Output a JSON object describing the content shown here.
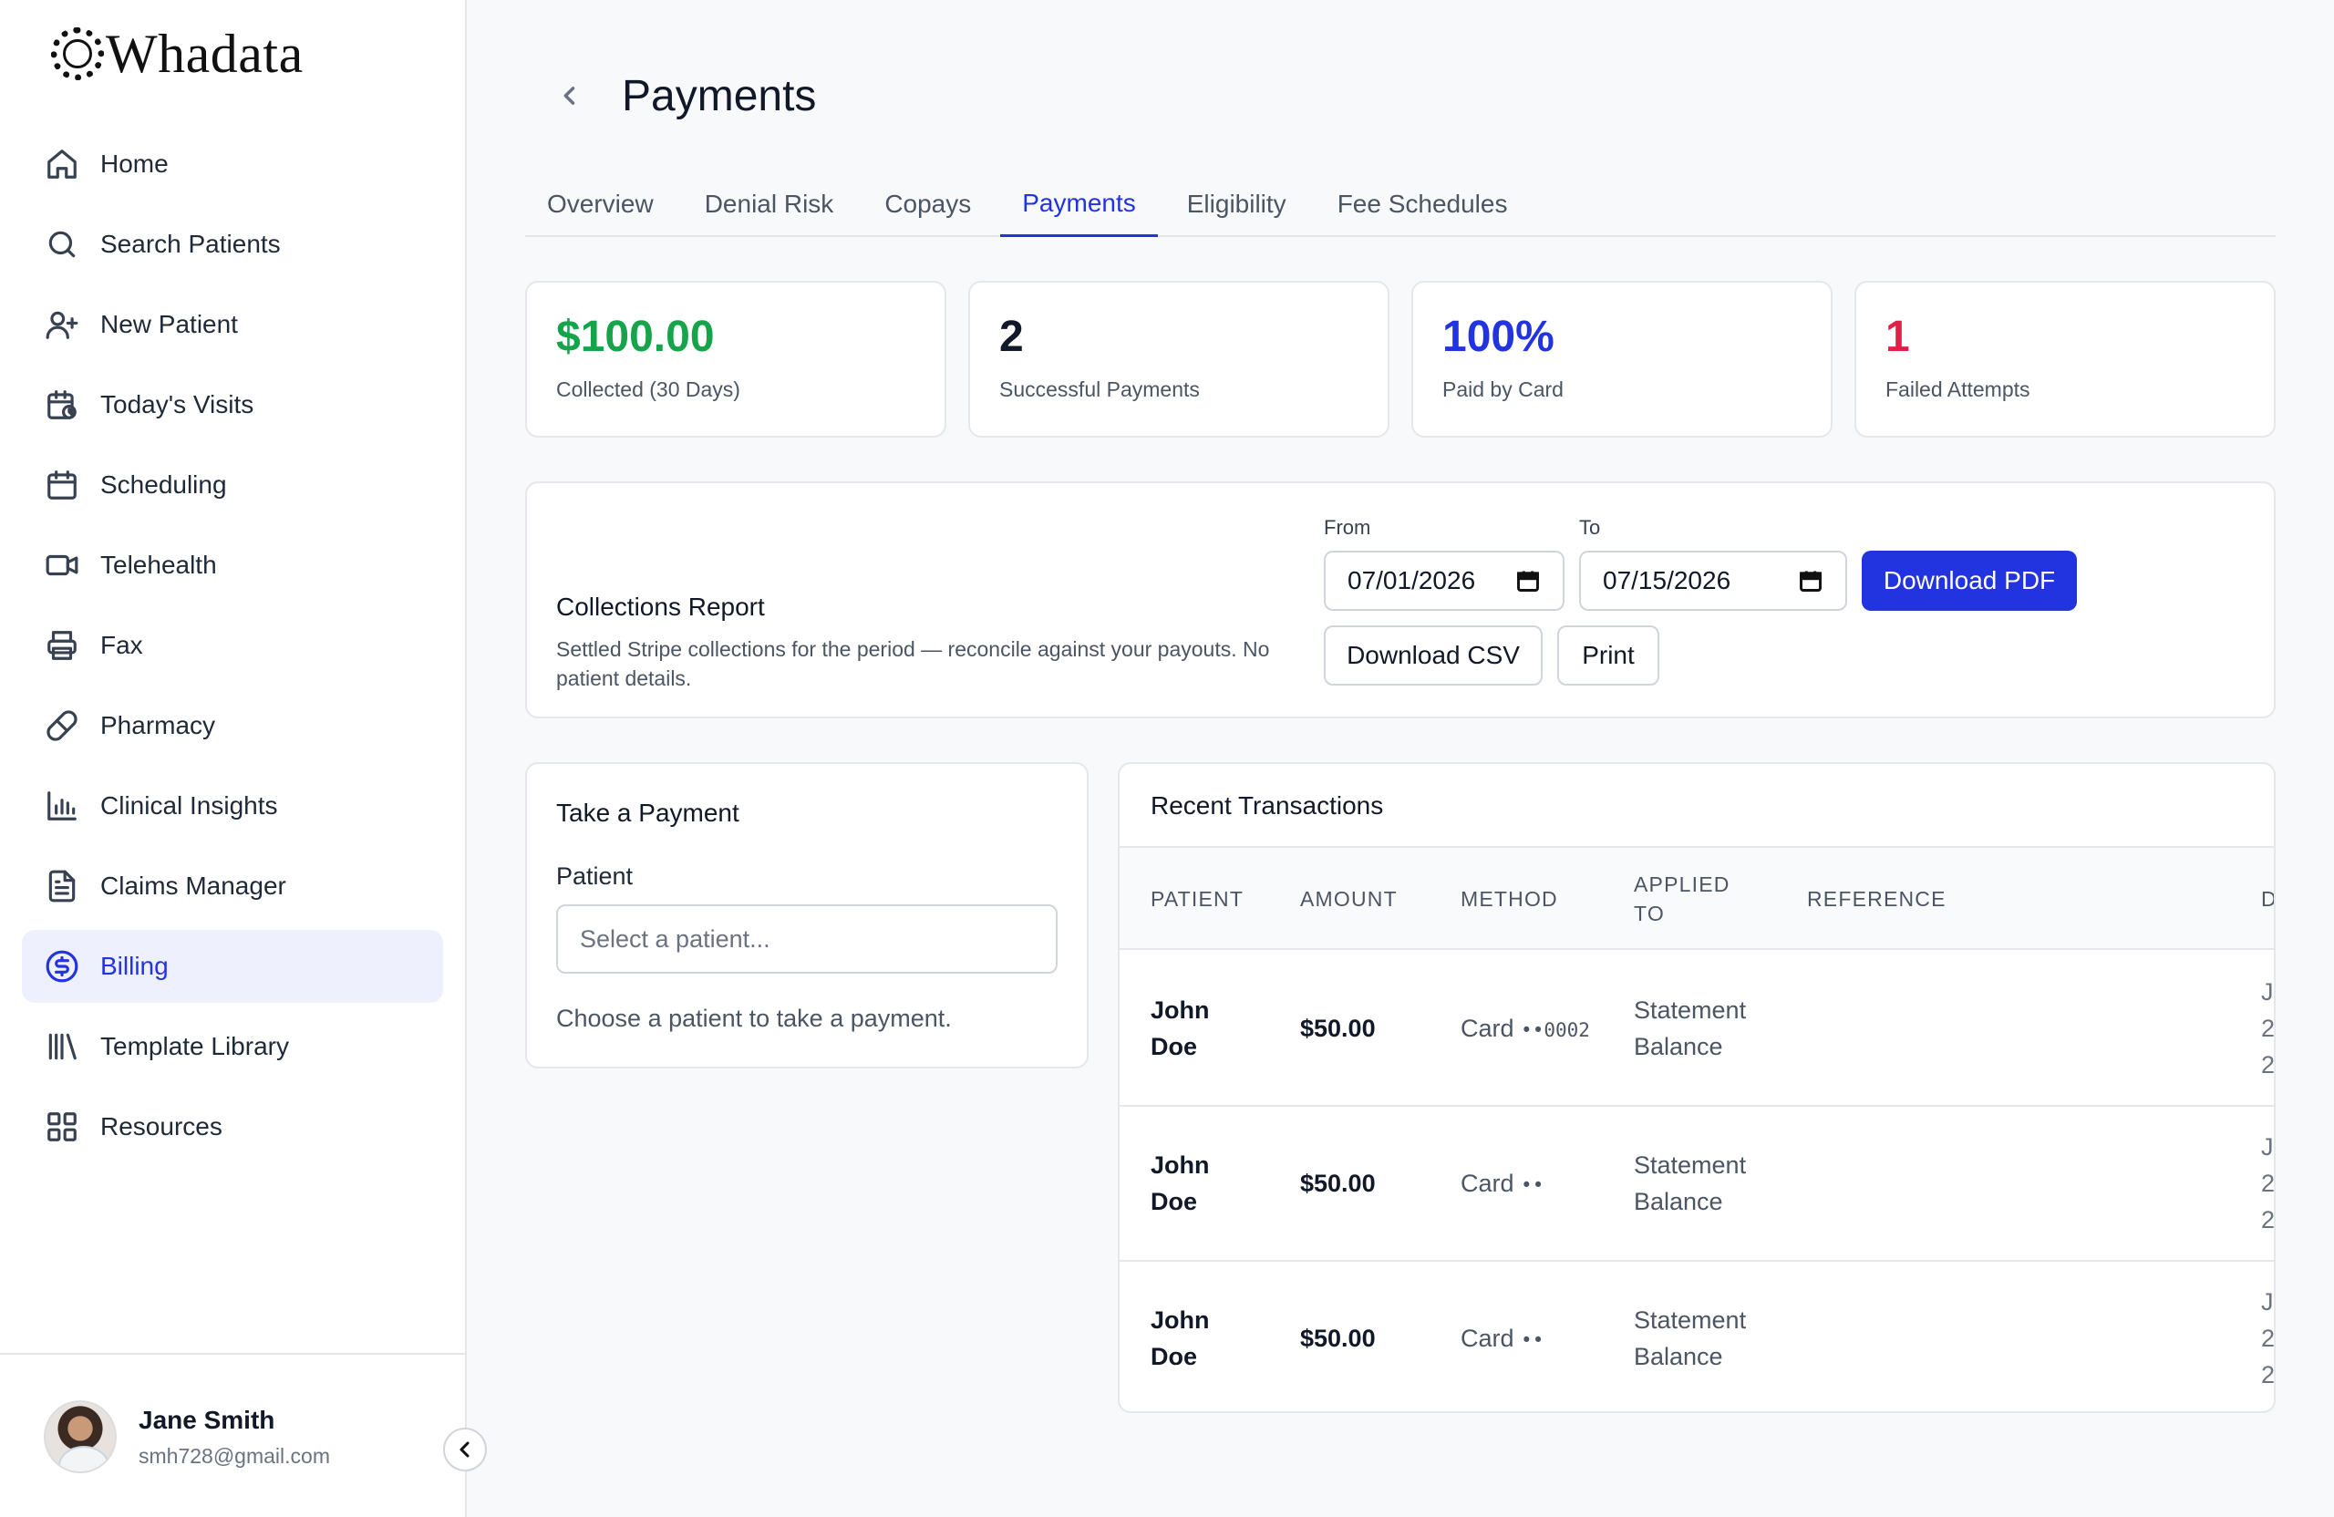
{
  "app": {
    "logo_text": "Whadata"
  },
  "sidebar": {
    "items": [
      {
        "label": "Home",
        "icon": "home-icon",
        "active": false
      },
      {
        "label": "Search Patients",
        "icon": "search-icon",
        "active": false
      },
      {
        "label": "New Patient",
        "icon": "user-plus-icon",
        "active": false
      },
      {
        "label": "Today's Visits",
        "icon": "calendar-clock-icon",
        "active": false
      },
      {
        "label": "Scheduling",
        "icon": "calendar-icon",
        "active": false
      },
      {
        "label": "Telehealth",
        "icon": "video-icon",
        "active": false
      },
      {
        "label": "Fax",
        "icon": "printer-icon",
        "active": false
      },
      {
        "label": "Pharmacy",
        "icon": "pill-icon",
        "active": false
      },
      {
        "label": "Clinical Insights",
        "icon": "bar-chart-icon",
        "active": false
      },
      {
        "label": "Claims Manager",
        "icon": "document-icon",
        "active": false
      },
      {
        "label": "Billing",
        "icon": "dollar-circle-icon",
        "active": true
      },
      {
        "label": "Template Library",
        "icon": "library-icon",
        "active": false
      },
      {
        "label": "Resources",
        "icon": "grid-icon",
        "active": false
      }
    ],
    "user": {
      "name": "Jane Smith",
      "email": "smh728@gmail.com"
    }
  },
  "header": {
    "title": "Payments"
  },
  "tabs": [
    {
      "label": "Overview",
      "active": false
    },
    {
      "label": "Denial Risk",
      "active": false
    },
    {
      "label": "Copays",
      "active": false
    },
    {
      "label": "Payments",
      "active": true
    },
    {
      "label": "Eligibility",
      "active": false
    },
    {
      "label": "Fee Schedules",
      "active": false
    }
  ],
  "stats": [
    {
      "value": "$100.00",
      "label": "Collected (30 Days)",
      "color": "#16a34a"
    },
    {
      "value": "2",
      "label": "Successful Payments",
      "color": "#111827"
    },
    {
      "value": "100%",
      "label": "Paid by Card",
      "color": "#2233e0"
    },
    {
      "value": "1",
      "label": "Failed Attempts",
      "color": "#e11d48"
    }
  ],
  "report": {
    "title": "Collections Report",
    "description": "Settled Stripe collections for the period — reconcile against your payouts. No patient details.",
    "from_label": "From",
    "from_value": "07/01/2026",
    "to_label": "To",
    "to_value": "07/15/2026",
    "download_pdf": "Download PDF",
    "download_csv": "Download CSV",
    "print": "Print"
  },
  "take_payment": {
    "title": "Take a Payment",
    "patient_label": "Patient",
    "patient_placeholder": "Select a patient...",
    "hint": "Choose a patient to take a payment."
  },
  "transactions": {
    "title": "Recent Transactions",
    "columns": [
      "PATIENT",
      "AMOUNT",
      "METHOD",
      "APPLIED TO",
      "REFERENCE",
      "D"
    ],
    "rows": [
      {
        "patient_first": "John",
        "patient_last": "Doe",
        "amount": "$50.00",
        "method": "Card",
        "card_suffix": "••0002",
        "applied_line1": "Statement",
        "applied_line2": "Balance",
        "reference": "",
        "date_1": "Ju",
        "date_2": "2",
        "date_3": "2"
      },
      {
        "patient_first": "John",
        "patient_last": "Doe",
        "amount": "$50.00",
        "method": "Card",
        "card_suffix": "••",
        "applied_line1": "Statement",
        "applied_line2": "Balance",
        "reference": "",
        "date_1": "Ju",
        "date_2": "2",
        "date_3": "2"
      },
      {
        "patient_first": "John",
        "patient_last": "Doe",
        "amount": "$50.00",
        "method": "Card",
        "card_suffix": "••",
        "applied_line1": "Statement",
        "applied_line2": "Balance",
        "reference": "",
        "date_1": "Ju",
        "date_2": "2",
        "date_3": "2"
      }
    ]
  }
}
